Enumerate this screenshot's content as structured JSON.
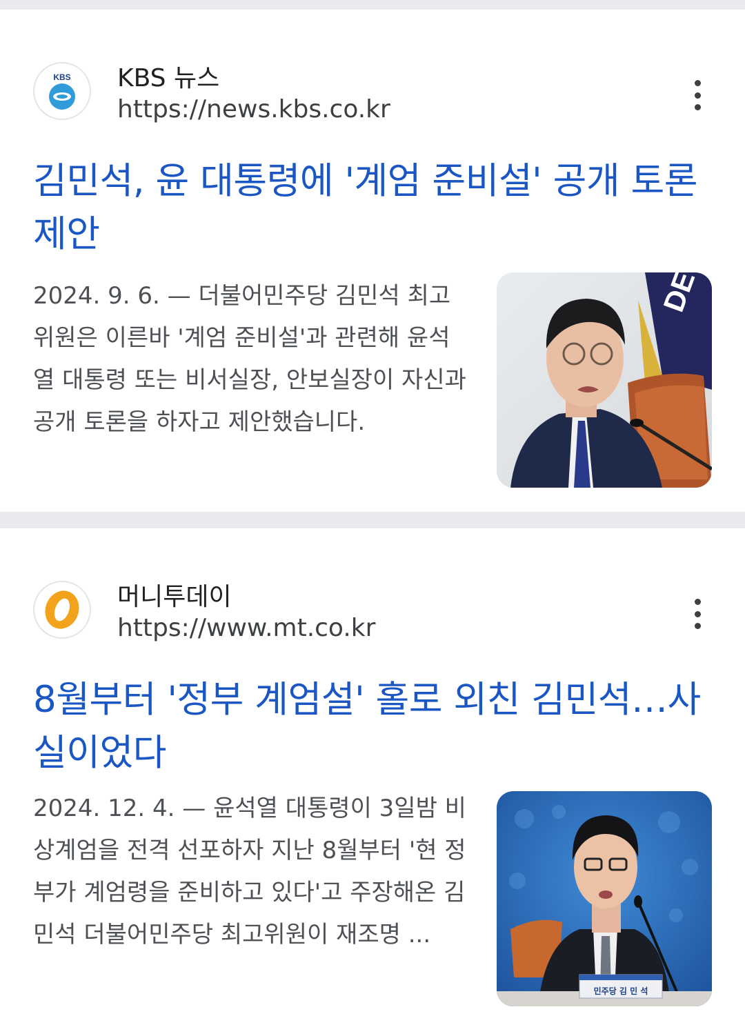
{
  "results": [
    {
      "source_name": "KBS 뉴스",
      "source_url": "https://news.kbs.co.kr",
      "logo_icon": "kbs-logo",
      "title": "김민석, 윤 대통령에 '계엄 준비설' 공개 토론 제안",
      "snippet": "2024. 9. 6. — 더불어민주당 김민석 최고위원은 이른바 '계엄 준비설'과 관련해 윤석열 대통령 또는 비서실장, 안보실장이 자신과 공개 토론을 하자고 제안했습니다.",
      "thumbnail": "politician-speaking-photo"
    },
    {
      "source_name": "머니투데이",
      "source_url": "https://www.mt.co.kr",
      "logo_icon": "moneytoday-logo",
      "title": "8월부터 '정부 계엄설' 홀로 외친 김민석…사실이었다",
      "snippet": "2024. 12. 4. — 윤석열 대통령이 3일밤 비상계엄을 전격 선포하자 지난 8월부터 '현 정부가 계엄령을 준비하고 있다'고 주장해온 김민석 더불어민주당 최고위원이 재조명 ...",
      "thumbnail": "politician-at-microphone-photo",
      "nameplate": "민주당 김 민 석"
    }
  ],
  "colors": {
    "title_link": "#1a56c4",
    "divider": "#e9eaee",
    "snippet_text": "#4d5156"
  }
}
